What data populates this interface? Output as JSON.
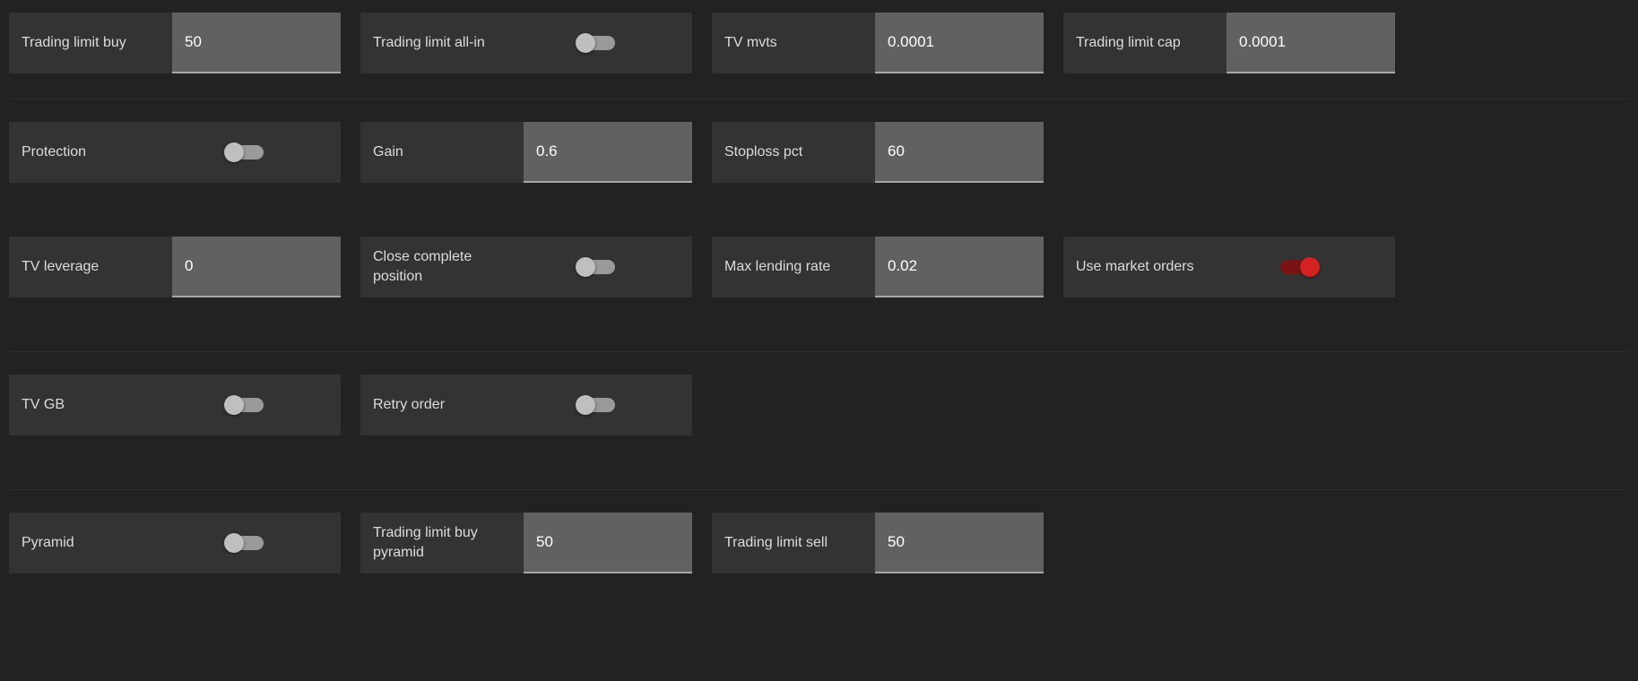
{
  "section1": {
    "row1": {
      "trading_limit_buy": {
        "label": "Trading limit buy",
        "value": "50"
      },
      "trading_limit_all_in": {
        "label": "Trading limit all-in",
        "state": "off"
      },
      "tv_mvts": {
        "label": "TV mvts",
        "value": "0.0001"
      },
      "trading_limit_cap": {
        "label": "Trading limit cap",
        "value": "0.0001"
      }
    },
    "row2": {
      "protection": {
        "label": "Protection",
        "state": "off"
      },
      "gain": {
        "label": "Gain",
        "value": "0.6"
      },
      "stoploss_pct": {
        "label": "Stoploss pct",
        "value": "60"
      }
    }
  },
  "section2": {
    "tv_leverage": {
      "label": "TV leverage",
      "value": "0"
    },
    "close_complete_position": {
      "label": "Close complete position",
      "state": "off"
    },
    "max_lending_rate": {
      "label": "Max lending rate",
      "value": "0.02"
    },
    "use_market_orders": {
      "label": "Use market orders",
      "state": "on_warn"
    }
  },
  "section3": {
    "tv_gb": {
      "label": "TV GB",
      "state": "off"
    },
    "retry_order": {
      "label": "Retry order",
      "state": "off"
    }
  },
  "section4": {
    "pyramid": {
      "label": "Pyramid",
      "state": "off"
    },
    "trading_limit_buy_pyramid": {
      "label": "Trading limit buy pyramid",
      "value": "50"
    },
    "trading_limit_sell": {
      "label": "Trading limit sell",
      "value": "50"
    }
  }
}
